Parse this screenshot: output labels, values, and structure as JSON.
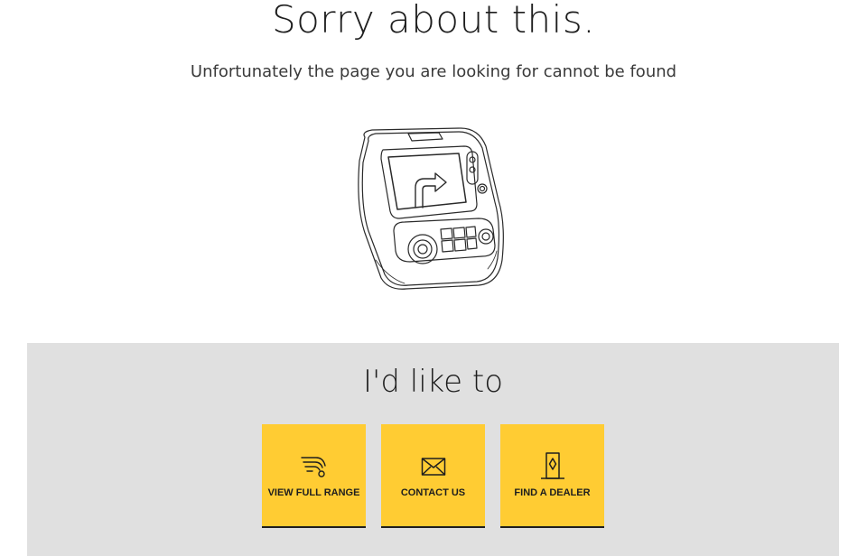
{
  "header": {
    "title": "Sorry about this.",
    "subtitle": "Unfortunately the page you are looking for cannot be found"
  },
  "illustration": {
    "icon": "car-dashboard-navigation-icon"
  },
  "actions": {
    "title": "I'd like to",
    "items": [
      {
        "label": "VIEW FULL RANGE",
        "icon": "car-range-icon"
      },
      {
        "label": "CONTACT US",
        "icon": "envelope-icon"
      },
      {
        "label": "FIND A DEALER",
        "icon": "dealer-door-icon"
      }
    ]
  },
  "colors": {
    "tile": "#ffcc33",
    "panel": "#e0e0e0",
    "text": "#1e1e1e"
  }
}
